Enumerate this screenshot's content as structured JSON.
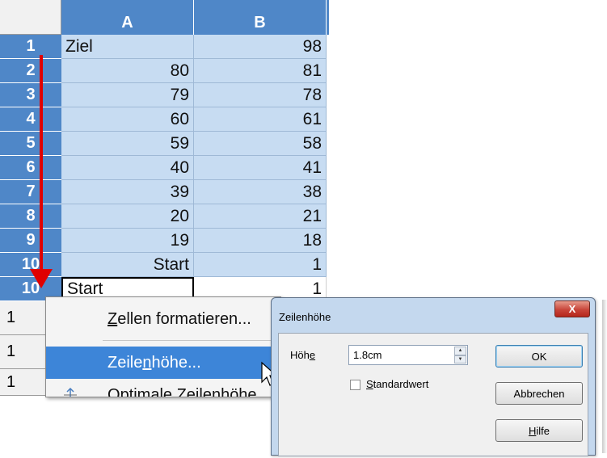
{
  "sheet": {
    "columns": [
      "A",
      "B"
    ],
    "row_headers": [
      "1",
      "2",
      "3",
      "4",
      "5",
      "6",
      "7",
      "8",
      "9",
      "10",
      "1",
      "1",
      "1"
    ],
    "rows": [
      {
        "a": "Ziel",
        "b": "98"
      },
      {
        "a": "80",
        "b": "81"
      },
      {
        "a": "79",
        "b": "78"
      },
      {
        "a": "60",
        "b": "61"
      },
      {
        "a": "59",
        "b": "58"
      },
      {
        "a": "40",
        "b": "41"
      },
      {
        "a": "39",
        "b": "38"
      },
      {
        "a": "20",
        "b": "21"
      },
      {
        "a": "19",
        "b": "18"
      },
      {
        "a": "Start",
        "b": "1"
      }
    ]
  },
  "context_menu": {
    "items": [
      {
        "label_pre": "",
        "label_ul": "Z",
        "label_post": "ellen formatieren..."
      },
      {
        "label_pre": "Zeile",
        "label_ul": "n",
        "label_post": "höhe..."
      },
      {
        "label_pre": "",
        "label_ul": "O",
        "label_post": "ptimale Zeilenhöhe..."
      }
    ]
  },
  "dialog": {
    "title": "Zeilenhöhe",
    "close_label": "X",
    "hoehe_label_pre": "Höh",
    "hoehe_label_ul": "e",
    "hoehe_value": "1.8cm",
    "checkbox_ul": "S",
    "checkbox_post": "tandardwert",
    "ok_label": "OK",
    "cancel_label": "Abbrechen",
    "help_ul": "H",
    "help_post": "ilfe"
  },
  "colors": {
    "selection_header": "#4f87c8",
    "selection_cell": "#c7dcf2",
    "arrow": "#e00000",
    "menu_highlight": "#3d85d8"
  }
}
